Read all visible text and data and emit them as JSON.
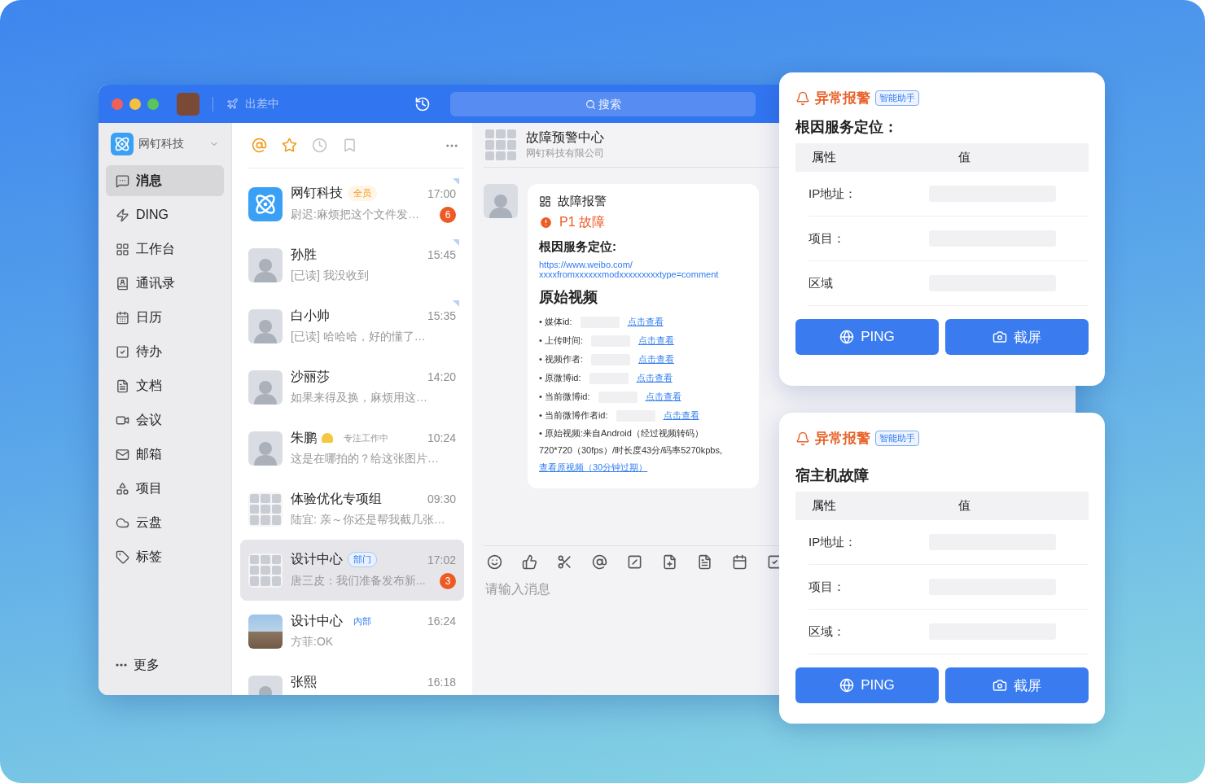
{
  "titlebar": {
    "status": "出差中",
    "search_placeholder": "搜索"
  },
  "sidebar": {
    "org": "网钉科技",
    "items": [
      {
        "label": "消息",
        "selected": true
      },
      {
        "label": "DING",
        "selected": false
      },
      {
        "label": "工作台",
        "selected": false
      },
      {
        "label": "通讯录",
        "selected": false
      },
      {
        "label": "日历",
        "selected": false
      },
      {
        "label": "待办",
        "selected": false
      },
      {
        "label": "文档",
        "selected": false
      },
      {
        "label": "会议",
        "selected": false
      },
      {
        "label": "邮箱",
        "selected": false
      },
      {
        "label": "项目",
        "selected": false
      },
      {
        "label": "云盘",
        "selected": false
      },
      {
        "label": "标签",
        "selected": false
      }
    ],
    "more": "更多"
  },
  "chat_list": {
    "conversations": [
      {
        "name": "网钉科技",
        "kind": "org",
        "tag": {
          "text": "全员",
          "kind": "all"
        },
        "time": "17:00",
        "preview": "尉迟:麻烦把这个文件发…",
        "unread": "6",
        "pinned": true,
        "selected": false
      },
      {
        "name": "孙胜",
        "kind": "person",
        "time": "15:45",
        "preview": "[已读] 我没收到",
        "pinned": true,
        "selected": false
      },
      {
        "name": "白小帅",
        "kind": "person",
        "time": "15:35",
        "preview": "[已读] 哈哈哈，好的懂了…",
        "pinned": true,
        "selected": false
      },
      {
        "name": "沙丽莎",
        "kind": "person",
        "time": "14:20",
        "preview": "如果来得及换，麻烦用这…",
        "pinned": false,
        "selected": false
      },
      {
        "name": "朱鹏",
        "kind": "person",
        "tag": {
          "text": "专注工作中",
          "kind": "status"
        },
        "time": "10:24",
        "preview": "这是在哪拍的？给这张图片…",
        "pinned": false,
        "selected": false
      },
      {
        "name": "体验优化专项组",
        "kind": "group",
        "time": "09:30",
        "preview": "陆宜: 亲～你还是帮我截几张…",
        "pinned": false,
        "selected": false
      },
      {
        "name": "设计中心",
        "kind": "group",
        "tag": {
          "text": "部门",
          "kind": "dept"
        },
        "time": "17:02",
        "preview": "唐三皮：我们准备发布新...",
        "unread": "3",
        "pinned": false,
        "selected": true
      },
      {
        "name": "设计中心",
        "kind": "photo",
        "tag": {
          "text": "内部",
          "kind": "internal"
        },
        "time": "16:24",
        "preview": "方菲:OK",
        "pinned": false,
        "selected": false
      },
      {
        "name": "张熙",
        "kind": "person",
        "time": "16:18",
        "pinned": false,
        "selected": false
      }
    ]
  },
  "chat": {
    "title": "故障预警中心",
    "subtitle": "网钉科技有限公司",
    "message": {
      "header": "故障报警",
      "severity": "P1 故障",
      "section": "根因服务定位:",
      "link_lines": [
        "https://www.weibo.com/",
        "xxxxfromxxxxxxmodxxxxxxxxxtype=comment"
      ],
      "video_title": "原始视频",
      "fields": [
        {
          "label": "• 媒体id:",
          "action": "点击查看"
        },
        {
          "label": "• 上传时间:",
          "action": "点击查看"
        },
        {
          "label": "• 视频作者:",
          "action": "点击查看"
        },
        {
          "label": "• 原微博id:",
          "action": "点击查看"
        },
        {
          "label": "• 当前微博id:",
          "action": "点击查看"
        },
        {
          "label": "• 当前微博作者id:",
          "action": "点击查看"
        }
      ],
      "note": "• 原始视频:来自Android（经过视频转码）",
      "note_detail": "720*720（30fps）/时长度43分/码率5270kpbs,",
      "note_link": "查看原视频（30分钟过期）"
    },
    "input_placeholder": "请输入消息"
  },
  "alerts": [
    {
      "title": "异常报警",
      "badge": "智能助手",
      "heading": "根因服务定位：",
      "columns": [
        "属性",
        "值"
      ],
      "rows": [
        "IP地址：",
        "项目：",
        "区域"
      ],
      "buttons": [
        "PING",
        "截屏"
      ]
    },
    {
      "title": "异常报警",
      "badge": "智能助手",
      "heading": "宿主机故障",
      "columns": [
        "属性",
        "值"
      ],
      "rows": [
        "IP地址：",
        "项目：",
        "区域："
      ],
      "buttons": [
        "PING",
        "截屏"
      ]
    }
  ]
}
